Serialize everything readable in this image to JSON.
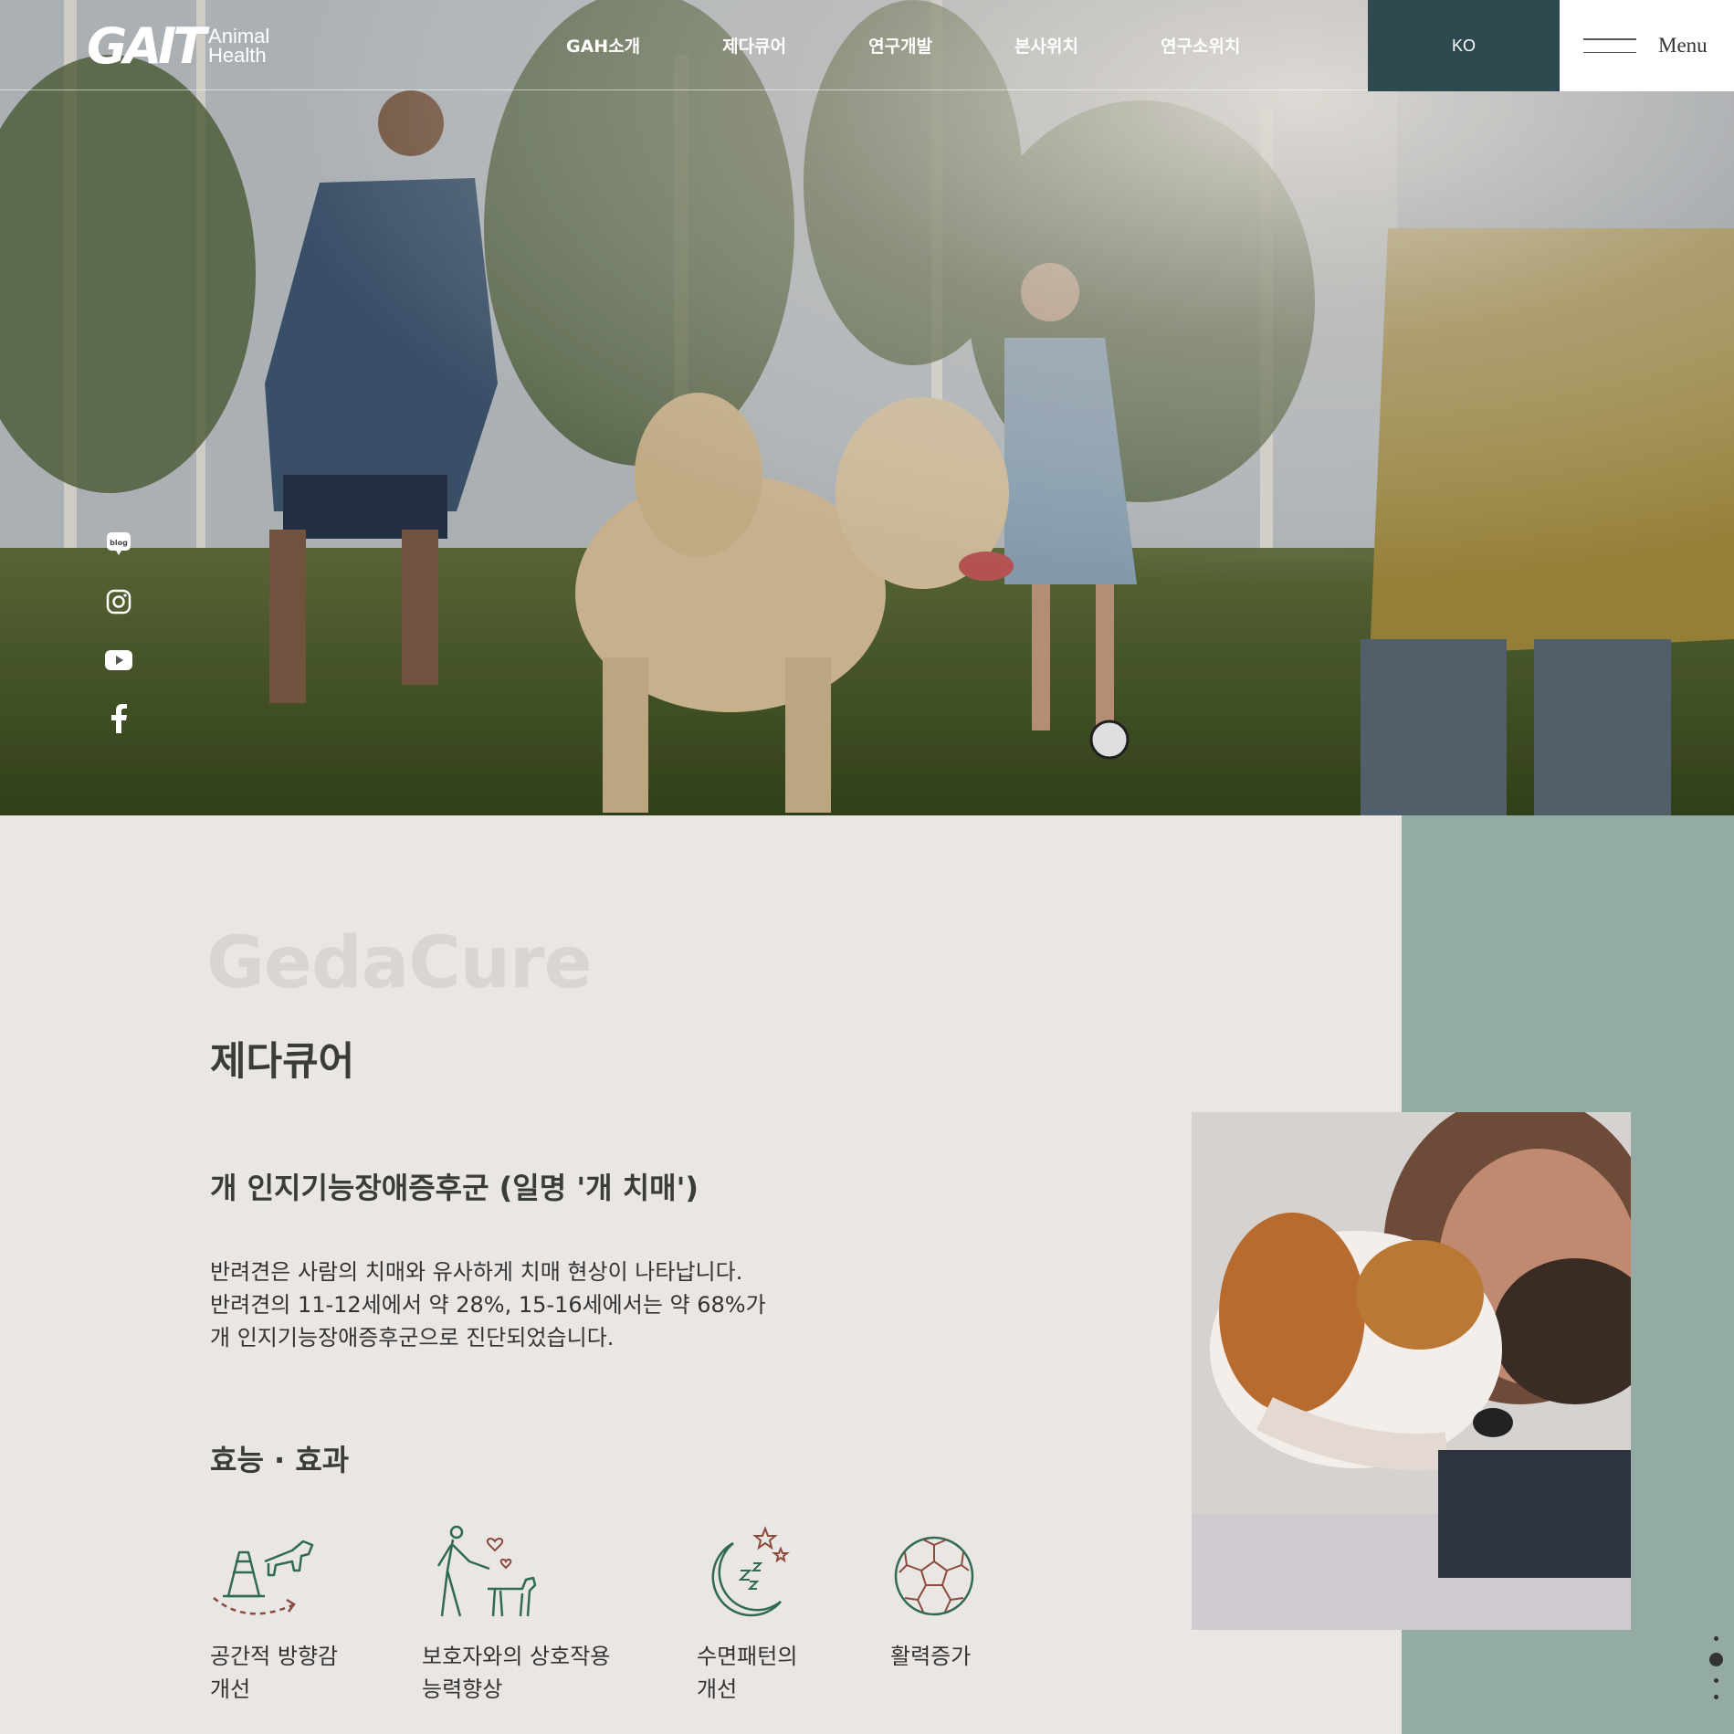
{
  "header": {
    "logo_mark": "GAIT",
    "logo_line1": "Animal",
    "logo_line2": "Health",
    "nav": [
      "GAH소개",
      "제다큐어",
      "연구개발",
      "본사위치",
      "연구소위치"
    ],
    "lang": "KO",
    "menu_label": "Menu"
  },
  "social": [
    "blog-icon",
    "instagram-icon",
    "youtube-icon",
    "facebook-icon"
  ],
  "content": {
    "brand_watermark": "GedaCure",
    "title": "제다큐어",
    "subtitle": "개 인지기능장애증후군 (일명 '개 치매')",
    "desc": [
      "반려견은 사람의 치매와 유사하게 치매 현상이 나타납니다.",
      "반려견의 11-12세에서 약 28%, 15-16세에서는 약 68%가",
      "개 인지기능장애증후군으로 진단되었습니다."
    ],
    "effects_title": "효능 · 효과",
    "effects": [
      {
        "icon": "cone-dog-icon",
        "line1": "공간적 방향감",
        "line2": "개선"
      },
      {
        "icon": "walking-dog-icon",
        "line1": "보호자와의 상호작용",
        "line2": "능력향상"
      },
      {
        "icon": "moon-sleep-icon",
        "line1": "수면패턴의",
        "line2": "개선"
      },
      {
        "icon": "ball-icon",
        "line1": "활력증가",
        "line2": ""
      }
    ]
  },
  "colors": {
    "header_lang_bg": "#2e4a50",
    "accent_panel": "#93aba3",
    "icon_green": "#2f6b4f",
    "icon_brown": "#8b4a3c"
  }
}
